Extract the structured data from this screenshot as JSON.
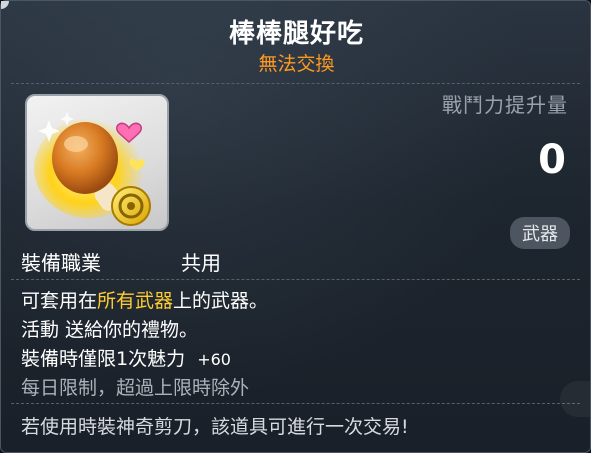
{
  "item": {
    "name": "棒棒腿好吃",
    "trade_status": "無法交換"
  },
  "stats": {
    "power_label": "戰鬥力提升量",
    "power_value": "0",
    "category_badge": "武器"
  },
  "job": {
    "label": "裝備職業",
    "value": "共用"
  },
  "description": {
    "line1_prefix": "可套用在",
    "line1_highlight": "所有武器",
    "line1_suffix": "上的武器。",
    "line2": "活動 送給你的禮物。",
    "line3_text": "裝備時僅限1次魅力",
    "line3_bonus": "+60",
    "line4": "每日限制，超過上限時除外"
  },
  "footer": {
    "notice": "若使用時裝神奇剪刀，該道具可進行一次交易!"
  },
  "colors": {
    "title": "#ffffff",
    "trade_status": "#ff9a1e",
    "highlight": "#ffcc33",
    "muted": "#aab2ba"
  },
  "icons": {
    "item": "drumstick-icon",
    "coin": "coin-icon",
    "heart": "heart-icon"
  }
}
